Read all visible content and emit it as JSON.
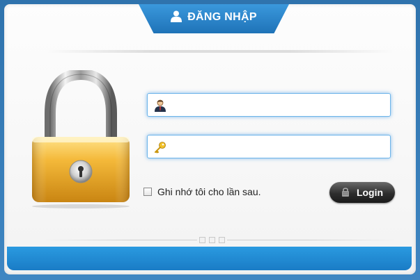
{
  "header": {
    "title": "ĐĂNG NHẬP",
    "icon": "user-icon"
  },
  "form": {
    "username": {
      "value": "",
      "placeholder": "",
      "icon": "user-avatar-icon"
    },
    "password": {
      "value": "",
      "placeholder": "",
      "icon": "key-icon"
    },
    "remember_label": "Ghi nhớ tôi cho lần sau.",
    "remember_checked": false,
    "login_label": "Login",
    "login_icon": "padlock-icon"
  },
  "colors": {
    "accent": "#1f7fc6",
    "field_glow": "#6cb4ea",
    "button": "#2e2e2e"
  }
}
